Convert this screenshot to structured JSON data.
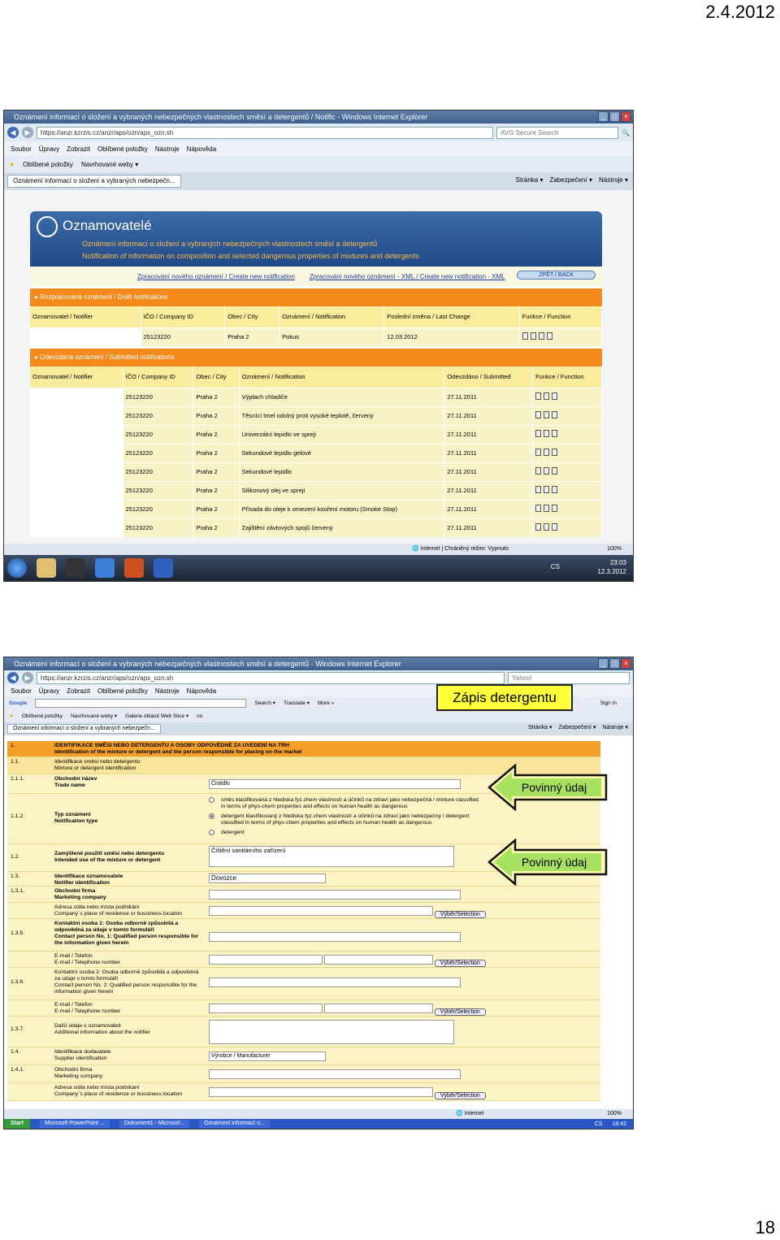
{
  "slide": {
    "date": "2.4.2012",
    "page_number": "18"
  },
  "shot1": {
    "window_title": "Oznámení informací o složení a vybraných nebezpečných vlastnostech směsí a detergentů / Notific - Windows Internet Explorer",
    "url": "https://anzr.kzrzis.cz/anzr/aps/ozn/aps_ozn.sh",
    "search_placeholder": "AVG Secure Search",
    "menu": [
      "Soubor",
      "Úpravy",
      "Zobrazit",
      "Oblíbené položky",
      "Nástroje",
      "Nápověda"
    ],
    "favorites": [
      "Oblíbené položky",
      "Navrhované weby ▾"
    ],
    "tab_label": "Oznámení informací o složení a vybraných nebezpečn...",
    "tab_tools": [
      "Stránka ▾",
      "Zabezpečení ▾",
      "Nástroje ▾"
    ],
    "app_title": "Oznamovatelé",
    "app_sub_cz": "Oznámení informací o složení a vybraných nebezpečných vlastnostech směsí a detergentů",
    "app_sub_en": "Notification of information on composition and selected dangerous properties of mixtures and detergents",
    "nav_new": "Zpracování nového oznámení / Create new notification",
    "nav_xml": "Zpracování nového oznámení - XML / Create new notification - XML",
    "nav_back": "ZPĚT / BACK",
    "draft_section": "▸ Rozpracovaná oznámení / Draft notifications",
    "draft_headers": [
      "Oznamovatel / Notifier",
      "IČO / Company ID",
      "Obec / City",
      "Oznámení / Notification",
      "Poslední změna / Last Change",
      "Funkce / Function"
    ],
    "draft_rows": [
      [
        "",
        "25123220",
        "Praha 2",
        "Pokus",
        "12.03.2012"
      ]
    ],
    "submitted_section": "▸ Odevzdaná oznámení / Submitted notifications",
    "submitted_headers": [
      "Oznamovatel / Notifier",
      "IČO / Company ID",
      "Obec / City",
      "Oznámení / Notification",
      "Odevzdáno / Submitted",
      "Funkce / Function"
    ],
    "submitted_rows": [
      [
        "",
        "25123220",
        "Praha 2",
        "Výplach chladiče",
        "27.11.2011"
      ],
      [
        "",
        "25123220",
        "Praha 2",
        "Těsnící tmel odolný proti vysoké teplotě, červený",
        "27.11.2011"
      ],
      [
        "",
        "25123220",
        "Praha 2",
        "Univerzální lepidlo ve spreji",
        "27.11.2011"
      ],
      [
        "",
        "25123220",
        "Praha 2",
        "Sekundové lepidlo gelové",
        "27.11.2011"
      ],
      [
        "",
        "25123220",
        "Praha 2",
        "Sekundové lepidlo",
        "27.11.2011"
      ],
      [
        "",
        "25123220",
        "Praha 2",
        "Silikonový olej ve spreji",
        "27.11.2011"
      ],
      [
        "",
        "25123220",
        "Praha 2",
        "Přísada do oleje k omezení kouření motoru (Smoke Stop)",
        "27.11.2011"
      ],
      [
        "",
        "25123220",
        "Praha 2",
        "Zajištění závtových spojů červený",
        "27.11.2011"
      ]
    ],
    "status_text": "Internet | Chráněný režim: Vypnuto",
    "zoom": "100%",
    "tray_lang": "CS",
    "clock_time": "23:03",
    "clock_date": "12.3.2012"
  },
  "shot2": {
    "window_title": "Oznámení informací o složení a vybraných nebezpečných vlastnostech směsí a detergentů - Windows Internet Explorer",
    "url": "https://anzr.kzrzis.cz/anzr/aps/ozn/aps_ozn.sh",
    "search_placeholder": "Yahoo!",
    "menu": [
      "Soubor",
      "Úpravy",
      "Zobrazit",
      "Oblíbené položky",
      "Nástroje",
      "Nápověda"
    ],
    "google_tools": [
      "Search ▾",
      "Translate ▾",
      "More »",
      "Sign In"
    ],
    "favorites": [
      "Oblíbené položky",
      "Navrhované weby ▾",
      "Galerie oblastí Web Slice ▾",
      "no"
    ],
    "tab_label": "Oznámení informací o složení a vybraných nebezpečn...",
    "tab_tools": [
      "Stránka ▾",
      "Zabezpečení ▾",
      "Nástroje ▾"
    ],
    "form_rows": [
      {
        "num": "1.",
        "label": "IDENTIFIKACE SMĚSI NEBO DETERGENTU A OSOBY ODPOVĚDNÉ ZA UVEDENÍ NA TRH",
        "label2": "Identification of the mixture or detergent and the person responsible for placing on the market"
      },
      {
        "num": "1.1.",
        "label": "Identifikace směsi nebo detergentu",
        "label2": "Mixture or detergent identification"
      },
      {
        "num": "1.1.1.",
        "label": "Obchodní název",
        "label2": "Trade name",
        "value": "Čistidlo"
      },
      {
        "num": "1.1.2.",
        "label": "Typ oznámení",
        "label2": "Notification type"
      },
      {
        "num": "1.2.",
        "label": "Zamýšlené použití směsi nebo detergentu",
        "label2": "Intended use of the mixture or detergent",
        "value": "Čištění sanitárního zařízení"
      },
      {
        "num": "1.3.",
        "label": "Identifikace oznamovatele",
        "label2": "Notifier identification",
        "value": "Dovozce"
      },
      {
        "num": "1.3.1.",
        "label": "Obchodní firma",
        "label2": "Marketing company"
      },
      {
        "num": "",
        "label": "Adresa sídla nebo místa podnikání",
        "label2": "Company´s place of residence or bussiness location",
        "button": "Výběr/Selection"
      },
      {
        "num": "1.3.5.",
        "label": "Kontaktní osoba 1: Osoba odborně způsobilá a odpovědná za údaje v tomto formuláři",
        "label2": "Contact person No. 1: Qualified person responsible for the information given herein"
      },
      {
        "num": "",
        "label": "E-mail / Telefon",
        "label2": "E-mail / Telephone number",
        "button": "Výběr/Selection"
      },
      {
        "num": "1.3.6.",
        "label": "Kontaktní osoba 2: Osoba odborně způsobilá a odpovědná za údaje v tomto formuláři",
        "label2": "Contact person No. 2: Qualified person responsible for the information given herein"
      },
      {
        "num": "",
        "label": "E-mail / Telefon",
        "label2": "E-mail / Telephone number",
        "button": "Výběr/Selection"
      },
      {
        "num": "1.3.7.",
        "label": "Další údaje o oznamovateli",
        "label2": "Additional information about the notifier"
      },
      {
        "num": "1.4.",
        "label": "Identifikace dodavatele",
        "label2": "Supplier identification",
        "value": "Výrobce / Manufacturer"
      },
      {
        "num": "1.4.1.",
        "label": "Obchodní firma",
        "label2": "Marketing company"
      },
      {
        "num": "",
        "label": "Adresa sídla nebo místa podnikání",
        "label2": "Company´s place of residence or bussiness location",
        "button": "Výběr/Selection"
      }
    ],
    "notif_type_options": [
      "směs klasifikovaná z hlediska fyz.chem vlastností a účinků na zdraví jako nebezpečná / mixture classified in terms of phys-chem properties and effects on human health as dangerous",
      "detergent klasifikovaný z hlediska fyz.chem vlastností a účinků na zdraví jako nebezpečný / detergent classified in terms of phys-chem properties and effects on human health as dangerous",
      "detergent"
    ],
    "status_text": "Internet",
    "zoom": "100%",
    "taskbar": [
      "Start",
      "Microsoft PowerPoint ...",
      "Dokument1 - Microsof...",
      "Oznámení informací o..."
    ],
    "clock": "18:42",
    "tray_lang": "CS"
  },
  "callouts": {
    "title": "Zápis detergentu",
    "required1": "Povinný údaj",
    "required2": "Povinný údaj"
  }
}
